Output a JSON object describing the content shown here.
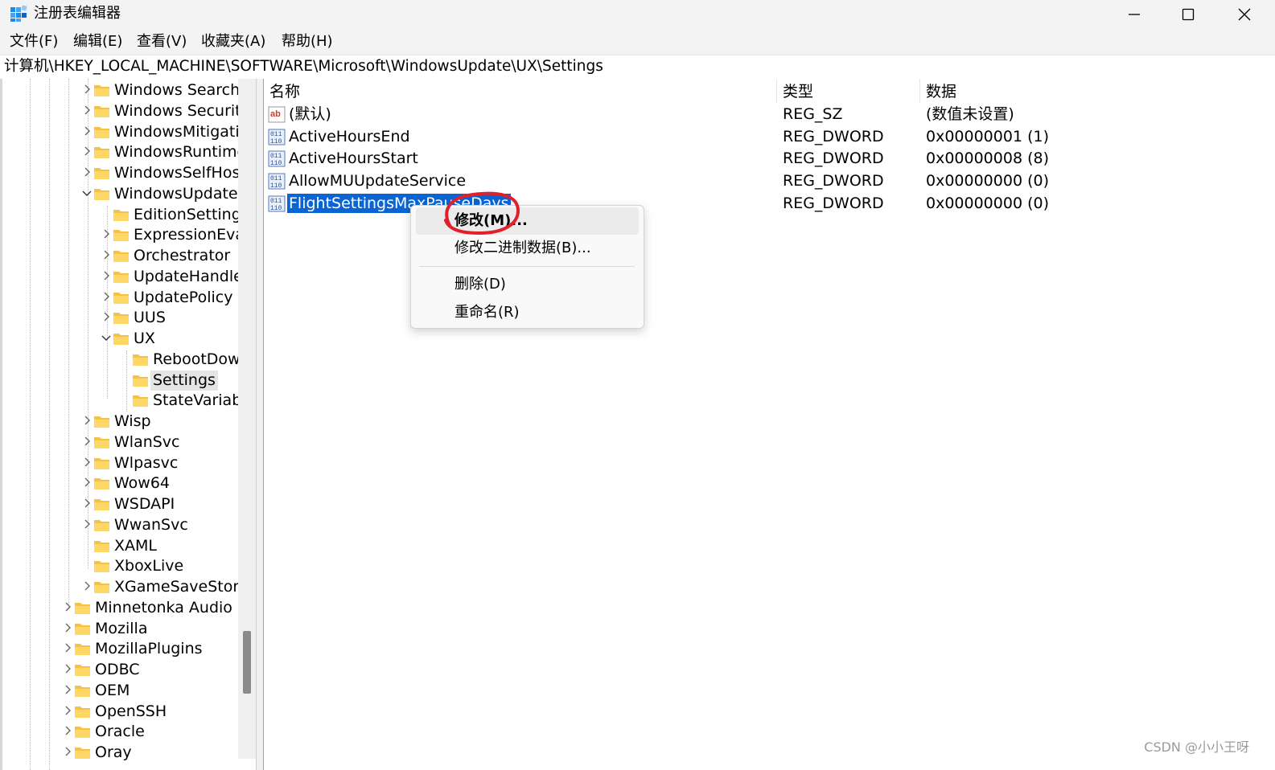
{
  "window": {
    "title": "注册表编辑器",
    "icon": "regedit-icon",
    "controls": [
      "minimize",
      "maximize",
      "close"
    ]
  },
  "menu": [
    "文件(F)",
    "编辑(E)",
    "查看(V)",
    "收藏夹(A)",
    "帮助(H)"
  ],
  "address": "计算机\\HKEY_LOCAL_MACHINE\\SOFTWARE\\Microsoft\\WindowsUpdate\\UX\\Settings",
  "tree": [
    {
      "label": "Windows Search",
      "level": 3,
      "chevron": "right"
    },
    {
      "label": "Windows Security",
      "level": 3,
      "chevron": "right"
    },
    {
      "label": "WindowsMitigation",
      "level": 3,
      "chevron": "right"
    },
    {
      "label": "WindowsRuntime",
      "level": 3,
      "chevron": "right"
    },
    {
      "label": "WindowsSelfHost",
      "level": 3,
      "chevron": "right"
    },
    {
      "label": "WindowsUpdate",
      "level": 3,
      "chevron": "down"
    },
    {
      "label": "EditionSettings",
      "level": 4,
      "chevron": "none"
    },
    {
      "label": "ExpressionEval",
      "level": 4,
      "chevron": "right"
    },
    {
      "label": "Orchestrator",
      "level": 4,
      "chevron": "right"
    },
    {
      "label": "UpdateHandle",
      "level": 4,
      "chevron": "right"
    },
    {
      "label": "UpdatePolicy",
      "level": 4,
      "chevron": "right"
    },
    {
      "label": "UUS",
      "level": 4,
      "chevron": "right"
    },
    {
      "label": "UX",
      "level": 4,
      "chevron": "down"
    },
    {
      "label": "RebootDow",
      "level": 5,
      "chevron": "none"
    },
    {
      "label": "Settings",
      "level": 5,
      "chevron": "none",
      "selected": true
    },
    {
      "label": "StateVariab",
      "level": 5,
      "chevron": "none"
    },
    {
      "label": "Wisp",
      "level": 3,
      "chevron": "right"
    },
    {
      "label": "WlanSvc",
      "level": 3,
      "chevron": "right"
    },
    {
      "label": "Wlpasvc",
      "level": 3,
      "chevron": "right"
    },
    {
      "label": "Wow64",
      "level": 3,
      "chevron": "right"
    },
    {
      "label": "WSDAPI",
      "level": 3,
      "chevron": "right"
    },
    {
      "label": "WwanSvc",
      "level": 3,
      "chevron": "right"
    },
    {
      "label": "XAML",
      "level": 3,
      "chevron": "none"
    },
    {
      "label": "XboxLive",
      "level": 3,
      "chevron": "none"
    },
    {
      "label": "XGameSaveStorag",
      "level": 3,
      "chevron": "right"
    },
    {
      "label": "Minnetonka Audio S",
      "level": 2,
      "chevron": "right"
    },
    {
      "label": "Mozilla",
      "level": 2,
      "chevron": "right"
    },
    {
      "label": "MozillaPlugins",
      "level": 2,
      "chevron": "right"
    },
    {
      "label": "ODBC",
      "level": 2,
      "chevron": "right"
    },
    {
      "label": "OEM",
      "level": 2,
      "chevron": "right"
    },
    {
      "label": "OpenSSH",
      "level": 2,
      "chevron": "right"
    },
    {
      "label": "Oracle",
      "level": 2,
      "chevron": "right"
    },
    {
      "label": "Oray",
      "level": 2,
      "chevron": "right"
    }
  ],
  "columns": {
    "name": "名称",
    "type": "类型",
    "data": "数据"
  },
  "values": [
    {
      "name": "(默认)",
      "type": "REG_SZ",
      "data": "(数值未设置)",
      "icon": "string-value-icon"
    },
    {
      "name": "ActiveHoursEnd",
      "type": "REG_DWORD",
      "data": "0x00000001 (1)",
      "icon": "binary-value-icon"
    },
    {
      "name": "ActiveHoursStart",
      "type": "REG_DWORD",
      "data": "0x00000008 (8)",
      "icon": "binary-value-icon"
    },
    {
      "name": "AllowMUUpdateService",
      "type": "REG_DWORD",
      "data": "0x00000000 (0)",
      "icon": "binary-value-icon"
    },
    {
      "name": "FlightSettingsMaxPauseDays",
      "type": "REG_DWORD",
      "data": "0x00000000 (0)",
      "icon": "binary-value-icon",
      "selected": true
    }
  ],
  "context_menu": {
    "modify": "修改(M)...",
    "modify_binary": "修改二进制数据(B)...",
    "delete": "删除(D)",
    "rename": "重命名(R)"
  },
  "annotation_color": "#e0202a",
  "selection_color": "#0a64d4",
  "watermark": "CSDN @小小王呀"
}
